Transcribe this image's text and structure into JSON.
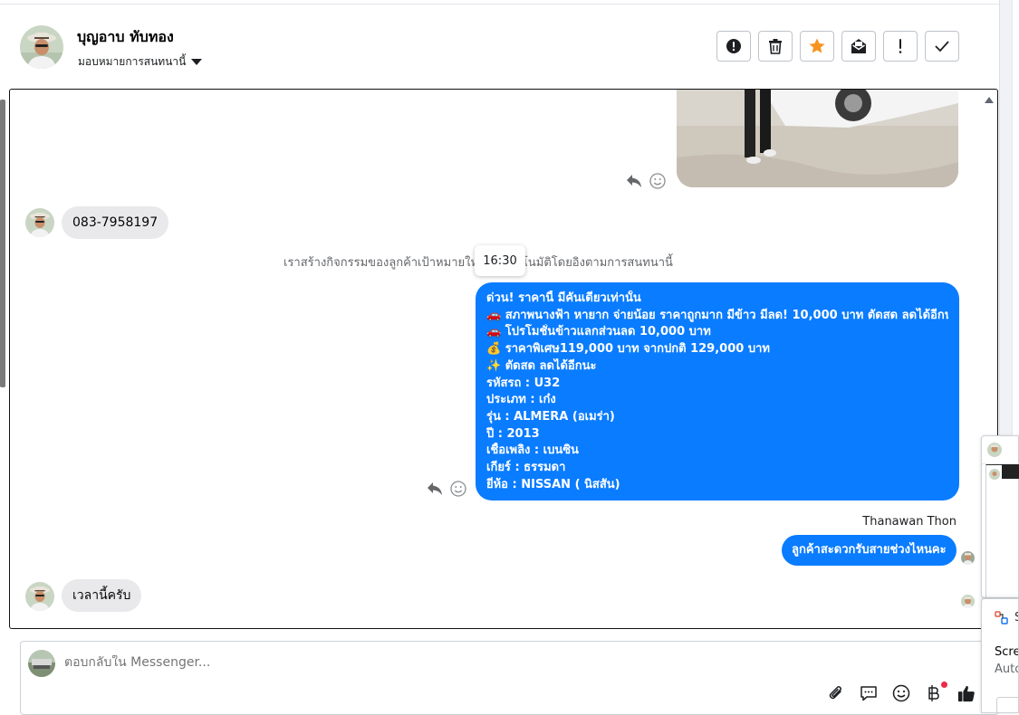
{
  "header": {
    "contact_name": "บุญอาบ ทับทอง",
    "assign_label": "มอบหมายการสนทนานี้",
    "toolbar_icons": [
      "alert-circle-icon",
      "trash-icon",
      "star-icon",
      "mark-unread-icon",
      "exclamation-icon",
      "check-icon"
    ],
    "star_color": "#f7931e"
  },
  "conversation": {
    "phone_message": "083-7958197",
    "system_message": "เราสร้างกิจกรรมของลูกค้าเป้าหมายใหม่โดยอัตโนมัติโดยอิงตามการสนทนานี้",
    "tooltip_time": "16:30",
    "outgoing_long": {
      "lines": [
        "ด่วน! ราคานี้ มีคันเดียวเท่านั้น",
        "🚗 สภาพนางฟ้า หายาก จ่ายน้อย ราคาถูกมาก มีข้าว มีลด! 10,000 บาท ตัดสด ลดได้อีกนะ",
        "🚗 โปรโมชั่นข้าวแลกส่วนลด 10,000 บาท",
        "💰 ราคาพิเศษ119,000 บาท จากปกติ 129,000 บาท",
        "✨ ตัดสด ลดได้อีกนะ",
        "รหัสรถ : U32",
        "ประเภท : เก๋ง",
        "รุ่น : ALMERA (อเมร่า)",
        "ปี : 2013",
        "เชื้อเพลิง : เบนซิน",
        "เกียร์ : ธรรมดา",
        "ยี่ห้อ : NISSAN ( นิสสัน)"
      ]
    },
    "sender_name": "Thanawan Thon",
    "outgoing_short": "ลูกค้าสะดวกรับสายช่วงไหนคะ",
    "incoming_last": "เวลานี้ครับ",
    "bubble_color": "#0a7cff"
  },
  "composer": {
    "placeholder": "ตอบกลับใน Messenger...",
    "icons": [
      "attachment-icon",
      "saved-replies-icon",
      "emoji-icon",
      "baht-payment-icon",
      "like-icon"
    ]
  },
  "side_popup": {
    "letter": "S",
    "title": "Scre",
    "subtitle": "Auto"
  }
}
